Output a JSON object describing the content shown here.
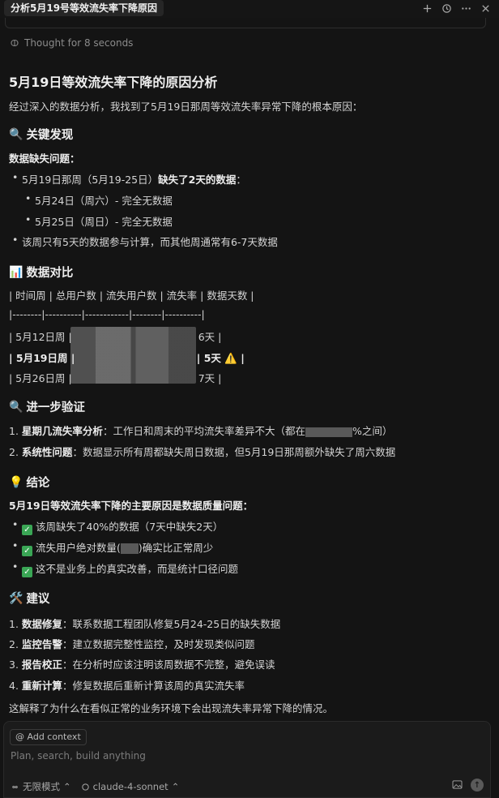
{
  "window": {
    "tab_title": "分析5月19号等效流失率下降原因"
  },
  "thought": {
    "label": "Thought for 8 seconds"
  },
  "doc": {
    "title": "5月19日等效流失率下降的原因分析",
    "intro": "经过深入的数据分析，我找到了5月19日那周等效流失率异常下降的根本原因：",
    "s1": {
      "emoji": "🔍",
      "heading": "关键发现",
      "sub": "数据缺失问题：",
      "b1_pre": "5月19日那周（5月19-25日）",
      "b1_bold": "缺失了2天的数据",
      "b1_post": "：",
      "b1a": "5月24日（周六）- 完全无数据",
      "b1b": "5月25日（周日）- 完全无数据",
      "b2": "该周只有5天的数据参与计算，而其他周通常有6-7天数据"
    },
    "s2": {
      "emoji": "📊",
      "heading": "数据对比",
      "header_row": "| 时间周 | 总用户数 | 流失用户数 | 流失率 | 数据天数 |",
      "sep_row": "|--------|----------|------------|--------|----------|",
      "r1_pre": "| 5月12日周 |",
      "r1_post": "6天 |",
      "r2_pre": "| 5月19日周 |",
      "r2_post": "| 5天",
      "r2_warn": "⚠️",
      "r2_end": "|",
      "r3_pre": "| 5月26日周 |",
      "r3_post": "7天 |"
    },
    "s3": {
      "emoji": "🔍",
      "heading": "进一步验证",
      "i1_num": "1.",
      "i1_bold": "星期几流失率分析",
      "i1_text": "：工作日和周末的平均流失率差异不大（都在",
      "i1_end": "%之间）",
      "i2_num": "2.",
      "i2_bold": "系统性问题",
      "i2_text": "：数据显示所有周都缺失周日数据，但5月19日那周额外缺失了周六数据"
    },
    "s4": {
      "emoji": "💡",
      "heading": "结论",
      "sub": "5月19日等效流失率下降的主要原因是数据质量问题：",
      "c1": "该周缺失了40%的数据（7天中缺失2天）",
      "c2_pre": "流失用户绝对数量(",
      "c2_post": ")确实比正常周少",
      "c3": "这不是业务上的真实改善，而是统计口径问题"
    },
    "s5": {
      "emoji": "🛠️",
      "heading": "建议",
      "items": [
        {
          "num": "1.",
          "bold": "数据修复",
          "text": "：联系数据工程团队修复5月24-25日的缺失数据"
        },
        {
          "num": "2.",
          "bold": "监控告警",
          "text": "：建立数据完整性监控，及时发现类似问题"
        },
        {
          "num": "3.",
          "bold": "报告校正",
          "text": "：在分析时应该注明该周数据不完整，避免误读"
        },
        {
          "num": "4.",
          "bold": "重新计算",
          "text": "：修复数据后重新计算该周的真实流失率"
        }
      ]
    },
    "closing": "这解释了为什么在看似正常的业务环境下会出现流失率异常下降的情况。"
  },
  "composer": {
    "add_context": "Add context",
    "placeholder": "Plan, search, build anything",
    "agent_label": "无限模式",
    "model_label": "claude-4-sonnet"
  }
}
